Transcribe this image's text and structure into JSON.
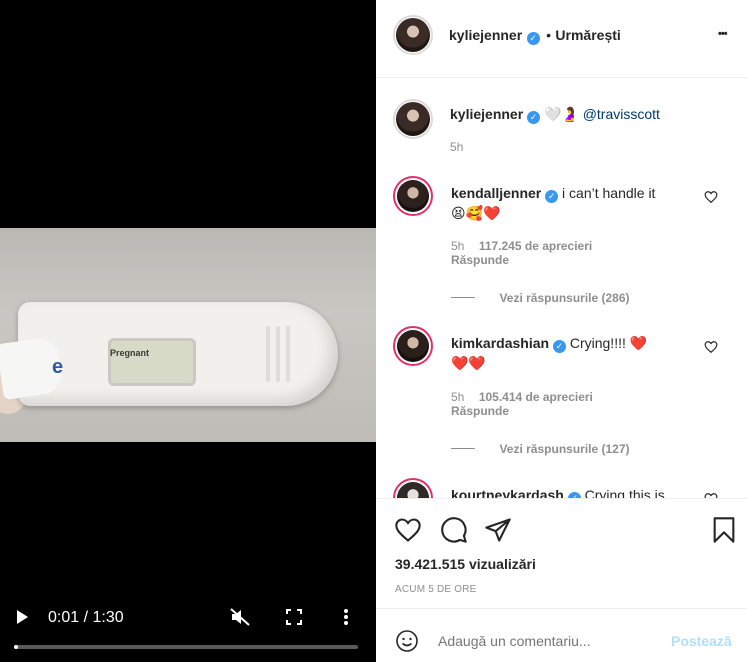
{
  "video": {
    "screen_text": "Pregnant",
    "brand_letter": "e",
    "time": "0:01 / 1:30",
    "progress": 0.0111,
    "icons": [
      "play-icon",
      "mute-icon",
      "fullscreen-icon",
      "more-vertical-icon"
    ]
  },
  "header": {
    "username": "kyliejenner",
    "separator": "•",
    "follow_status": "Urmărești",
    "more": "•••"
  },
  "caption": {
    "username": "kyliejenner",
    "text": "🤍🤰",
    "mention": "@travisscott",
    "time": "5h"
  },
  "comments": [
    {
      "username": "kendalljenner",
      "text": "i can’t handle it",
      "emoji": "😫🥰❤️",
      "time": "5h",
      "likes": "117.245 de aprecieri",
      "reply": "Răspunde",
      "view_replies": "Vezi răspunsurile (286)"
    },
    {
      "username": "kimkardashian",
      "text": "Crying!!!! ❤️",
      "emoji": "❤️❤️",
      "time": "5h",
      "likes": "105.414 de aprecieri",
      "reply": "Răspunde",
      "view_replies": "Vezi răspunsurile (127)"
    },
    {
      "username": "kourtneykardash",
      "text": "Crying this is"
    }
  ],
  "actions": {
    "views": "39.421.515 vizualizări",
    "age": "ACUM 5 DE ORE"
  },
  "add_comment": {
    "placeholder": "Adaugă un comentariu...",
    "post": "Postează"
  },
  "colors": {
    "verified": "#3897f0",
    "link": "#00376b",
    "post_disabled": "#b2dffc",
    "heart": "#ed4956"
  }
}
